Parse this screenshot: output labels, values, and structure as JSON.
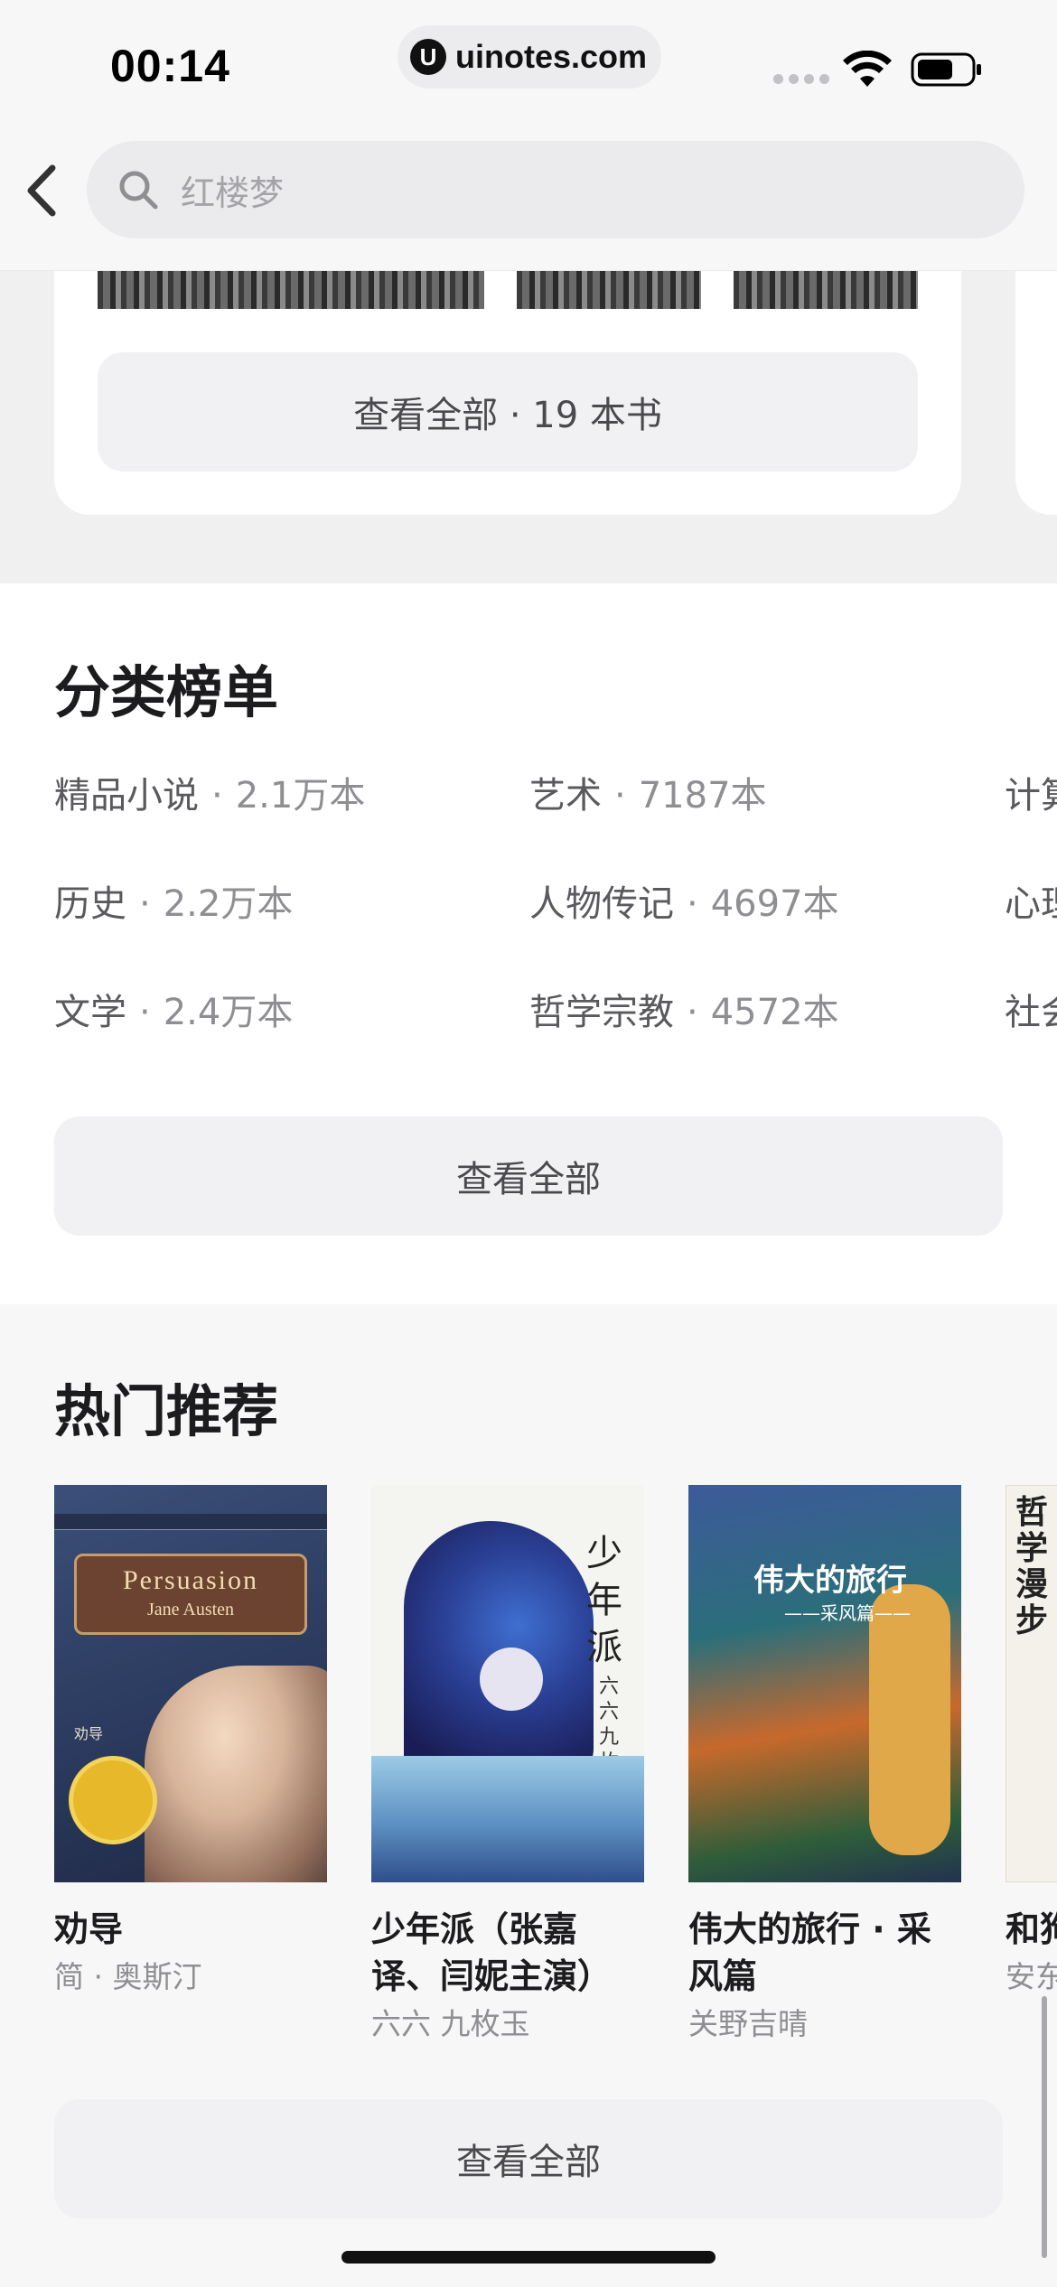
{
  "status_bar": {
    "time": "00:14",
    "url": "uinotes.com",
    "url_logo": "U"
  },
  "search": {
    "placeholder": "红楼梦"
  },
  "top_card": {
    "view_all_label": "查看全部 · 19 本书"
  },
  "category": {
    "title": "分类榜单",
    "items": [
      {
        "name": "精品小说",
        "count": "2.1万本"
      },
      {
        "name": "艺术",
        "count": "7187本"
      },
      {
        "name": "计算",
        "count": ""
      },
      {
        "name": "历史",
        "count": "2.2万本"
      },
      {
        "name": "人物传记",
        "count": "4697本"
      },
      {
        "name": "心理",
        "count": ""
      },
      {
        "name": "文学",
        "count": "2.4万本"
      },
      {
        "name": "哲学宗教",
        "count": "4572本"
      },
      {
        "name": "社会",
        "count": ""
      }
    ],
    "separator": "·",
    "view_all_label": "查看全部"
  },
  "hot": {
    "title": "热门推荐",
    "books": [
      {
        "title": "劝导",
        "author": "简 · 奥斯汀",
        "cover_title": "Persuasion",
        "cover_author": "Jane Austen",
        "cover_small": "劝导"
      },
      {
        "title": "少年派（张嘉译、闫妮主演）",
        "author": "六六 九枚玉",
        "cover_title": "少年派",
        "cover_sub": "六六 九枚玉"
      },
      {
        "title": "伟大的旅行 · 采风篇",
        "author": "关野吉晴",
        "cover_title": "伟大的旅行",
        "cover_sub": "——采风篇——"
      },
      {
        "title": "和狗学漫",
        "author": "安东",
        "cover_title": "哲学漫步"
      }
    ],
    "view_all_label": "查看全部"
  },
  "colors": {
    "background": "#f7f7f8",
    "card": "#ffffff",
    "button": "#f1f1f3",
    "text_primary": "#1c1c1e",
    "text_secondary": "#8e8e93"
  }
}
